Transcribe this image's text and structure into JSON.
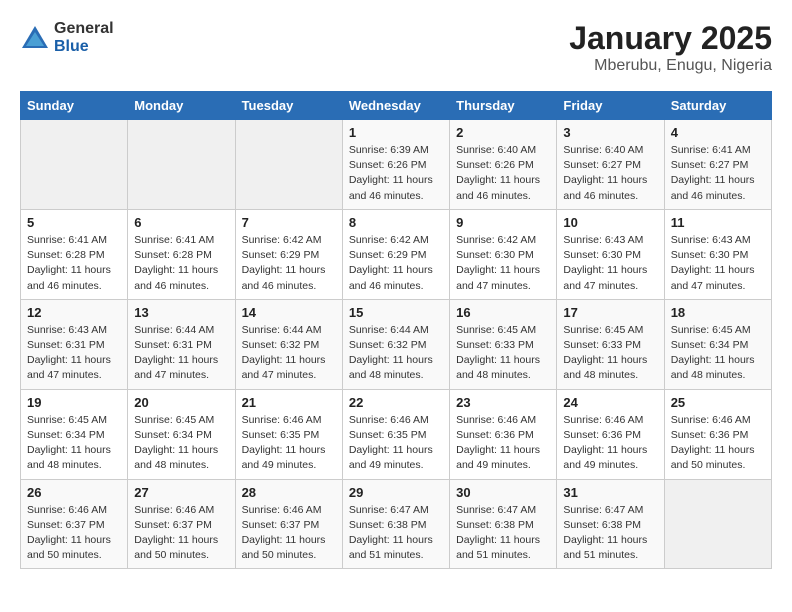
{
  "logo": {
    "general": "General",
    "blue": "Blue"
  },
  "title": "January 2025",
  "subtitle": "Mberubu, Enugu, Nigeria",
  "days_of_week": [
    "Sunday",
    "Monday",
    "Tuesday",
    "Wednesday",
    "Thursday",
    "Friday",
    "Saturday"
  ],
  "weeks": [
    [
      {
        "day": "",
        "info": ""
      },
      {
        "day": "",
        "info": ""
      },
      {
        "day": "",
        "info": ""
      },
      {
        "day": "1",
        "info": "Sunrise: 6:39 AM\nSunset: 6:26 PM\nDaylight: 11 hours and 46 minutes."
      },
      {
        "day": "2",
        "info": "Sunrise: 6:40 AM\nSunset: 6:26 PM\nDaylight: 11 hours and 46 minutes."
      },
      {
        "day": "3",
        "info": "Sunrise: 6:40 AM\nSunset: 6:27 PM\nDaylight: 11 hours and 46 minutes."
      },
      {
        "day": "4",
        "info": "Sunrise: 6:41 AM\nSunset: 6:27 PM\nDaylight: 11 hours and 46 minutes."
      }
    ],
    [
      {
        "day": "5",
        "info": "Sunrise: 6:41 AM\nSunset: 6:28 PM\nDaylight: 11 hours and 46 minutes."
      },
      {
        "day": "6",
        "info": "Sunrise: 6:41 AM\nSunset: 6:28 PM\nDaylight: 11 hours and 46 minutes."
      },
      {
        "day": "7",
        "info": "Sunrise: 6:42 AM\nSunset: 6:29 PM\nDaylight: 11 hours and 46 minutes."
      },
      {
        "day": "8",
        "info": "Sunrise: 6:42 AM\nSunset: 6:29 PM\nDaylight: 11 hours and 46 minutes."
      },
      {
        "day": "9",
        "info": "Sunrise: 6:42 AM\nSunset: 6:30 PM\nDaylight: 11 hours and 47 minutes."
      },
      {
        "day": "10",
        "info": "Sunrise: 6:43 AM\nSunset: 6:30 PM\nDaylight: 11 hours and 47 minutes."
      },
      {
        "day": "11",
        "info": "Sunrise: 6:43 AM\nSunset: 6:30 PM\nDaylight: 11 hours and 47 minutes."
      }
    ],
    [
      {
        "day": "12",
        "info": "Sunrise: 6:43 AM\nSunset: 6:31 PM\nDaylight: 11 hours and 47 minutes."
      },
      {
        "day": "13",
        "info": "Sunrise: 6:44 AM\nSunset: 6:31 PM\nDaylight: 11 hours and 47 minutes."
      },
      {
        "day": "14",
        "info": "Sunrise: 6:44 AM\nSunset: 6:32 PM\nDaylight: 11 hours and 47 minutes."
      },
      {
        "day": "15",
        "info": "Sunrise: 6:44 AM\nSunset: 6:32 PM\nDaylight: 11 hours and 48 minutes."
      },
      {
        "day": "16",
        "info": "Sunrise: 6:45 AM\nSunset: 6:33 PM\nDaylight: 11 hours and 48 minutes."
      },
      {
        "day": "17",
        "info": "Sunrise: 6:45 AM\nSunset: 6:33 PM\nDaylight: 11 hours and 48 minutes."
      },
      {
        "day": "18",
        "info": "Sunrise: 6:45 AM\nSunset: 6:34 PM\nDaylight: 11 hours and 48 minutes."
      }
    ],
    [
      {
        "day": "19",
        "info": "Sunrise: 6:45 AM\nSunset: 6:34 PM\nDaylight: 11 hours and 48 minutes."
      },
      {
        "day": "20",
        "info": "Sunrise: 6:45 AM\nSunset: 6:34 PM\nDaylight: 11 hours and 48 minutes."
      },
      {
        "day": "21",
        "info": "Sunrise: 6:46 AM\nSunset: 6:35 PM\nDaylight: 11 hours and 49 minutes."
      },
      {
        "day": "22",
        "info": "Sunrise: 6:46 AM\nSunset: 6:35 PM\nDaylight: 11 hours and 49 minutes."
      },
      {
        "day": "23",
        "info": "Sunrise: 6:46 AM\nSunset: 6:36 PM\nDaylight: 11 hours and 49 minutes."
      },
      {
        "day": "24",
        "info": "Sunrise: 6:46 AM\nSunset: 6:36 PM\nDaylight: 11 hours and 49 minutes."
      },
      {
        "day": "25",
        "info": "Sunrise: 6:46 AM\nSunset: 6:36 PM\nDaylight: 11 hours and 50 minutes."
      }
    ],
    [
      {
        "day": "26",
        "info": "Sunrise: 6:46 AM\nSunset: 6:37 PM\nDaylight: 11 hours and 50 minutes."
      },
      {
        "day": "27",
        "info": "Sunrise: 6:46 AM\nSunset: 6:37 PM\nDaylight: 11 hours and 50 minutes."
      },
      {
        "day": "28",
        "info": "Sunrise: 6:46 AM\nSunset: 6:37 PM\nDaylight: 11 hours and 50 minutes."
      },
      {
        "day": "29",
        "info": "Sunrise: 6:47 AM\nSunset: 6:38 PM\nDaylight: 11 hours and 51 minutes."
      },
      {
        "day": "30",
        "info": "Sunrise: 6:47 AM\nSunset: 6:38 PM\nDaylight: 11 hours and 51 minutes."
      },
      {
        "day": "31",
        "info": "Sunrise: 6:47 AM\nSunset: 6:38 PM\nDaylight: 11 hours and 51 minutes."
      },
      {
        "day": "",
        "info": ""
      }
    ]
  ]
}
